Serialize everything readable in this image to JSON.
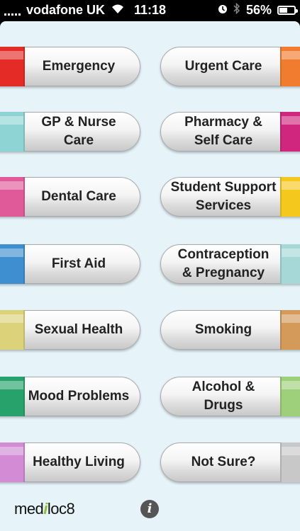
{
  "status_bar": {
    "carrier": "vodafone UK",
    "time": "11:18",
    "battery_percent": "56%",
    "battery_level": 0.56,
    "icons": [
      "signal-icon",
      "wifi-icon",
      "clock-icon",
      "bluetooth-icon",
      "battery-charging-icon"
    ]
  },
  "menu": {
    "left": [
      {
        "label": "Emergency",
        "color": "#e42b26"
      },
      {
        "label": "GP & Nurse\nCare",
        "color": "#8fd4d4"
      },
      {
        "label": "Dental Care",
        "color": "#e05a9a"
      },
      {
        "label": "First Aid",
        "color": "#3e8fd0"
      },
      {
        "label": "Sexual Health",
        "color": "#dcd27a"
      },
      {
        "label": "Mood Problems",
        "color": "#27a26a"
      },
      {
        "label": "Healthy Living",
        "color": "#d28bd4"
      }
    ],
    "right": [
      {
        "label": "Urgent Care",
        "color": "#f17b2e"
      },
      {
        "label": "Pharmacy &\nSelf Care",
        "color": "#d0267e"
      },
      {
        "label": "Student Support\nServices",
        "color": "#f5c81e"
      },
      {
        "label": "Contraception\n& Pregnancy",
        "color": "#a7d8d8"
      },
      {
        "label": "Smoking",
        "color": "#d39a5a"
      },
      {
        "label": "Alcohol &\nDrugs",
        "color": "#9ecf7a"
      },
      {
        "label": "Not Sure?",
        "color": "#c8c8c8"
      }
    ]
  },
  "footer": {
    "logo_prefix": "med",
    "logo_i": "i",
    "logo_suffix": "loc8",
    "info_icon": "i"
  }
}
